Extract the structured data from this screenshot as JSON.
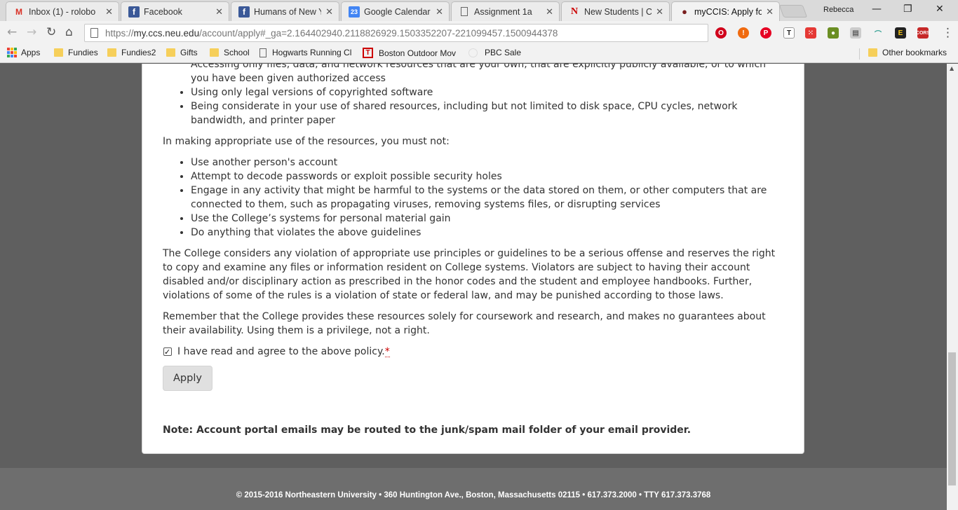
{
  "browser": {
    "tabs": [
      {
        "title": "Inbox (1) - rolobo",
        "icon": "gmail-icon",
        "active": false
      },
      {
        "title": "Facebook",
        "icon": "facebook-icon",
        "active": false
      },
      {
        "title": "Humans of New Y",
        "icon": "facebook-icon",
        "active": false
      },
      {
        "title": "Google Calendar -",
        "icon": "calendar-icon",
        "active": false
      },
      {
        "title": "Assignment 1a",
        "icon": "document-icon",
        "active": false
      },
      {
        "title": "New Students | CC",
        "icon": "northeastern-icon",
        "active": false
      },
      {
        "title": "myCCIS: Apply for",
        "icon": "paw-icon",
        "active": true
      }
    ],
    "user_name": "Rebecca",
    "address": {
      "prefix": "https://",
      "host": "my.ccs.neu.edu",
      "path": "/account/apply#_ga=2.164402940.2118826929.1503352207-221099457.1500944378"
    },
    "bookmarks": [
      {
        "label": "Apps",
        "type": "apps"
      },
      {
        "label": "Fundies",
        "type": "folder"
      },
      {
        "label": "Fundies2",
        "type": "folder"
      },
      {
        "label": "Gifts",
        "type": "folder"
      },
      {
        "label": "School",
        "type": "folder"
      },
      {
        "label": "Hogwarts Running Cl",
        "type": "page"
      },
      {
        "label": "Boston Outdoor Mov",
        "type": "page"
      },
      {
        "label": "PBC Sale",
        "type": "page"
      }
    ],
    "other_bookmarks": "Other bookmarks"
  },
  "page": {
    "partial_first_line": "Accessing only files, data, and network resources that are your own, that are explicitly publicly available, or to which",
    "list_allowed": [
      "you have been given authorized access",
      "Using only legal versions of copyrighted software",
      "Being considerate in your use of shared resources, including but not limited to disk space, CPU cycles, network bandwidth, and printer paper"
    ],
    "must_not_intro": "In making appropriate use of the resources, you must not:",
    "list_not": [
      "Use another person's account",
      "Attempt to decode passwords or exploit possible security holes",
      "Engage in any activity that might be harmful to the systems or the data stored on them, or other computers that are connected to them, such as propagating viruses, removing systems files, or disrupting services",
      "Use the College’s systems for personal material gain",
      "Do anything that violates the above guidelines"
    ],
    "violation_paragraph": "The College considers any violation of appropriate use principles or guidelines to be a serious offense and reserves the right to copy and examine any files or information resident on College systems. Violators are subject to having their account disabled and/or disciplinary action as prescribed in the honor codes and the student and employee handbooks. Further, violations of some of the rules is a violation of state or federal law, and may be punished according to those laws.",
    "remember_paragraph": "Remember that the College provides these resources solely for coursework and research, and makes no guarantees about their availability. Using them is a privilege, not a right.",
    "agree_label": "I have read and agree to the above policy.",
    "required_mark": "*",
    "agree_checked": true,
    "apply_label": "Apply",
    "note": "Note: Account portal emails may be routed to the junk/spam mail folder of your email provider.",
    "footer": "© 2015-2016 Northeastern University • 360 Huntington Ave., Boston, Massachusetts 02115 • 617.373.2000 • TTY 617.373.3768"
  }
}
